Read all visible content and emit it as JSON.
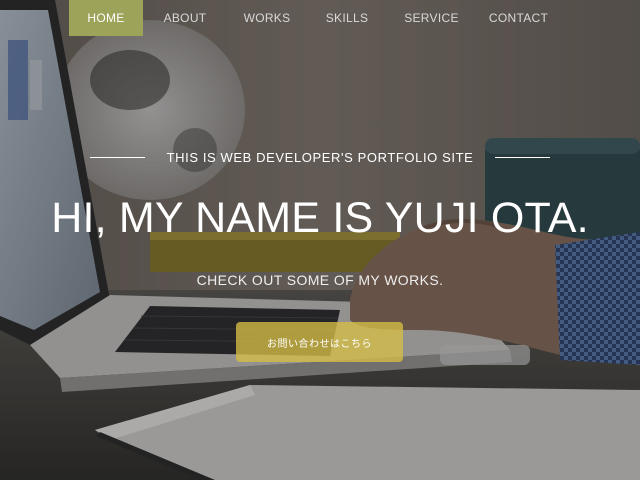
{
  "nav": {
    "items": [
      {
        "label": "HOME",
        "active": true
      },
      {
        "label": "ABOUT",
        "active": false
      },
      {
        "label": "WORKS",
        "active": false
      },
      {
        "label": "SKILLS",
        "active": false
      },
      {
        "label": "SERVICE",
        "active": false
      },
      {
        "label": "CONTACT",
        "active": false
      }
    ],
    "active_color": "#9ea35a"
  },
  "hero": {
    "tagline": "THIS IS WEB DEVELOPER'S PORTFOLIO SITE",
    "headline": "HI, MY NAME IS YUJI OTA.",
    "subline": "CHECK OUT SOME OF MY WORKS.",
    "cta_label": "お問い合わせはこちら",
    "cta_color": "#d6be46"
  }
}
